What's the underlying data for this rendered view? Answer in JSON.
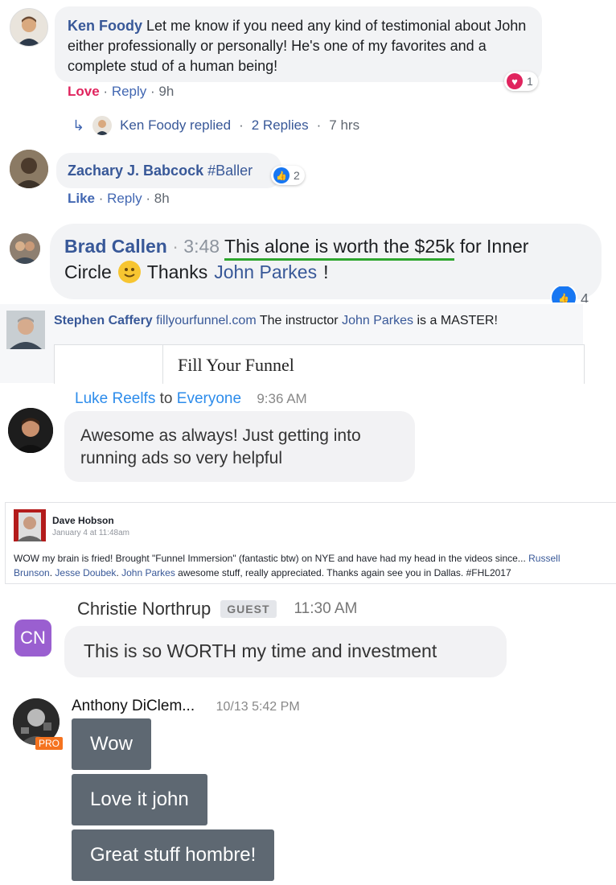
{
  "c1": {
    "author": "Ken Foody",
    "text": "Let me know if you need any kind of testimonial about John either professionally or personally! He's one of my favorites and a complete stud of a human being!",
    "love": "Love",
    "reply": "Reply",
    "time": "9h",
    "reaction_count": "1",
    "replied_author": "Ken Foody replied",
    "replies": "2 Replies",
    "replies_time": "7 hrs"
  },
  "c2": {
    "author": "Zachary J. Babcock",
    "text": "#Baller",
    "like": "Like",
    "reply": "Reply",
    "time": "8h",
    "reaction_count": "2"
  },
  "c3": {
    "author": "Brad Callen",
    "timestamp": "3:48",
    "text_underlined": "This alone is worth the $25k",
    "text_rest": "for Inner",
    "line2_text": "Circle",
    "line2_thanks": "Thanks",
    "mention": "John Parkes",
    "exclaim": "!",
    "reaction_count": "4"
  },
  "c4": {
    "author": "Stephen Caffery",
    "site": "fillyourfunnel.com",
    "text_pre": "The instructor",
    "mention": "John Parkes",
    "text_post": "is a MASTER!",
    "card_title": "Fill Your Funnel"
  },
  "c5": {
    "author": "Luke Reelfs",
    "to": "to",
    "audience": "Everyone",
    "time": "9:36 AM",
    "message": "Awesome as always! Just getting into running ads so very helpful"
  },
  "c6": {
    "author": "Dave Hobson",
    "date": "January 4 at 11:48am",
    "text1": "WOW my brain is fried! Brought \"Funnel Immersion\" (fantastic btw) on NYE and have had my head in the videos since...",
    "mention1": "Russell",
    "mention1b": "Brunson",
    "sep1": ".",
    "mention2": "Jesse Doubek",
    "sep2": ".",
    "mention3": "John Parkes",
    "text2": "awesome stuff, really appreciated. Thanks again see you in Dallas. #FHL2017"
  },
  "c7": {
    "initials": "CN",
    "author": "Christie Northrup",
    "badge": "GUEST",
    "time": "11:30 AM",
    "message": "This is so WORTH my time and investment"
  },
  "c8": {
    "author": "Anthony DiClem...",
    "time": "10/13 5:42 PM",
    "pro": "PRO",
    "messages": [
      "Wow",
      "Love it john",
      "Great stuff hombre!"
    ]
  },
  "colors": {
    "fb_blue": "#385898",
    "love_red": "#e0245e",
    "cn_purple": "#9a5fd0",
    "pro_orange": "#f5731f",
    "underline_green": "#2ea62e",
    "msg_gray": "#5e6872"
  }
}
